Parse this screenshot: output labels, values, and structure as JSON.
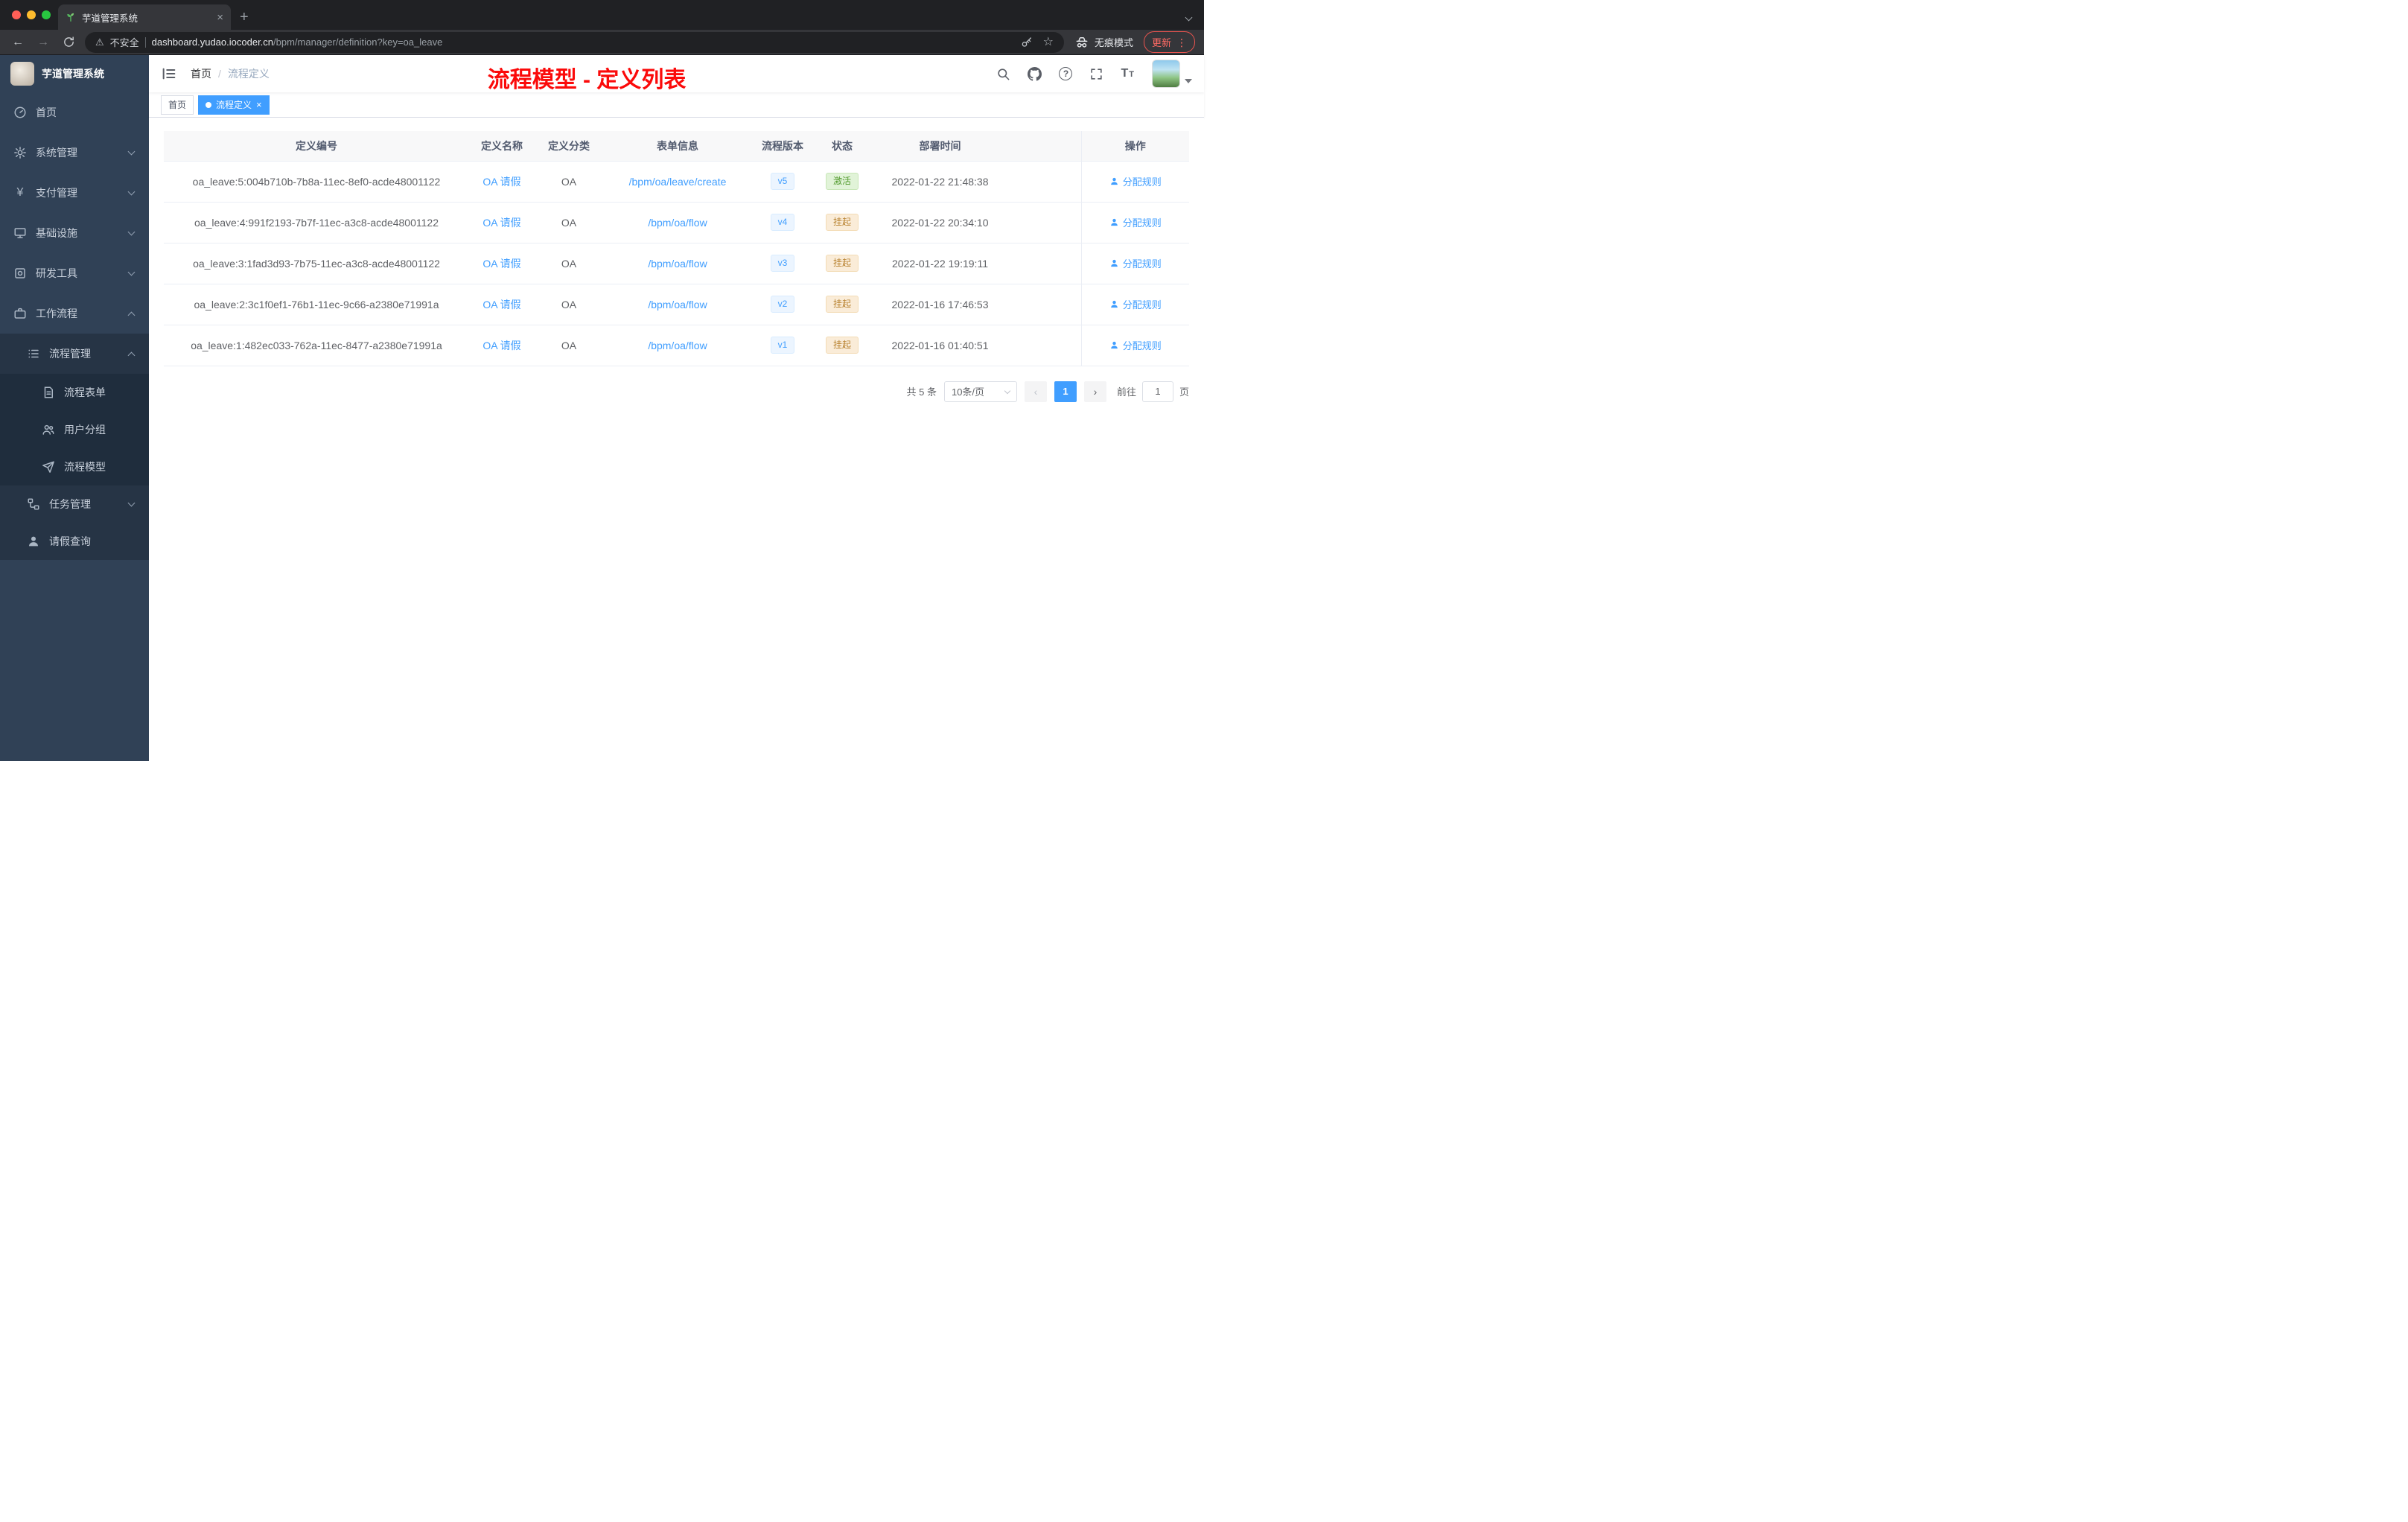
{
  "browser": {
    "tab_title": "芋道管理系统",
    "security_label": "不安全",
    "url_host": "dashboard.yudao.iocoder.cn",
    "url_path": "/bpm/manager/definition?key=oa_leave",
    "incognito_label": "无痕模式",
    "update_label": "更新"
  },
  "sidebar": {
    "title": "芋道管理系统",
    "items": [
      {
        "label": "首页"
      },
      {
        "label": "系统管理"
      },
      {
        "label": "支付管理"
      },
      {
        "label": "基础设施"
      },
      {
        "label": "研发工具"
      },
      {
        "label": "工作流程"
      },
      {
        "label": "流程管理"
      },
      {
        "label": "流程表单"
      },
      {
        "label": "用户分组"
      },
      {
        "label": "流程模型"
      },
      {
        "label": "任务管理"
      },
      {
        "label": "请假查询"
      }
    ]
  },
  "navbar": {
    "breadcrumb_root": "首页",
    "breadcrumb_separator": "/",
    "breadcrumb_current": "流程定义",
    "annotation": "流程模型 - 定义列表"
  },
  "tags_view": {
    "tags": [
      {
        "label": "首页"
      },
      {
        "label": "流程定义"
      }
    ]
  },
  "table": {
    "columns": {
      "id": "定义编号",
      "name": "定义名称",
      "category": "定义分类",
      "form": "表单信息",
      "version": "流程版本",
      "status": "状态",
      "deploy_time": "部署时间",
      "action": "操作"
    },
    "rows": [
      {
        "id": "oa_leave:5:004b710b-7b8a-11ec-8ef0-acde48001122",
        "name": "OA 请假",
        "category": "OA",
        "form": "/bpm/oa/leave/create",
        "version": "v5",
        "status": "激活",
        "deploy_time": "2022-01-22 21:48:38",
        "action": "分配规则"
      },
      {
        "id": "oa_leave:4:991f2193-7b7f-11ec-a3c8-acde48001122",
        "name": "OA 请假",
        "category": "OA",
        "form": "/bpm/oa/flow",
        "version": "v4",
        "status": "挂起",
        "deploy_time": "2022-01-22 20:34:10",
        "action": "分配规则"
      },
      {
        "id": "oa_leave:3:1fad3d93-7b75-11ec-a3c8-acde48001122",
        "name": "OA 请假",
        "category": "OA",
        "form": "/bpm/oa/flow",
        "version": "v3",
        "status": "挂起",
        "deploy_time": "2022-01-22 19:19:11",
        "action": "分配规则"
      },
      {
        "id": "oa_leave:2:3c1f0ef1-76b1-11ec-9c66-a2380e71991a",
        "name": "OA 请假",
        "category": "OA",
        "form": "/bpm/oa/flow",
        "version": "v2",
        "status": "挂起",
        "deploy_time": "2022-01-16 17:46:53",
        "action": "分配规则"
      },
      {
        "id": "oa_leave:1:482ec033-762a-11ec-8477-a2380e71991a",
        "name": "OA 请假",
        "category": "OA",
        "form": "/bpm/oa/flow",
        "version": "v1",
        "status": "挂起",
        "deploy_time": "2022-01-16 01:40:51",
        "action": "分配规则"
      }
    ]
  },
  "pagination": {
    "total": "共 5 条",
    "page_size": "10条/页",
    "current_page": "1",
    "goto_label": "前往",
    "goto_value": "1",
    "goto_unit": "页"
  },
  "colors": {
    "primary": "#409eff",
    "success": "#529b2e",
    "warning": "#b88230",
    "annotation_red": "#fb0a0a",
    "sidebar_bg": "#304156",
    "chrome_dark": "#202124"
  }
}
